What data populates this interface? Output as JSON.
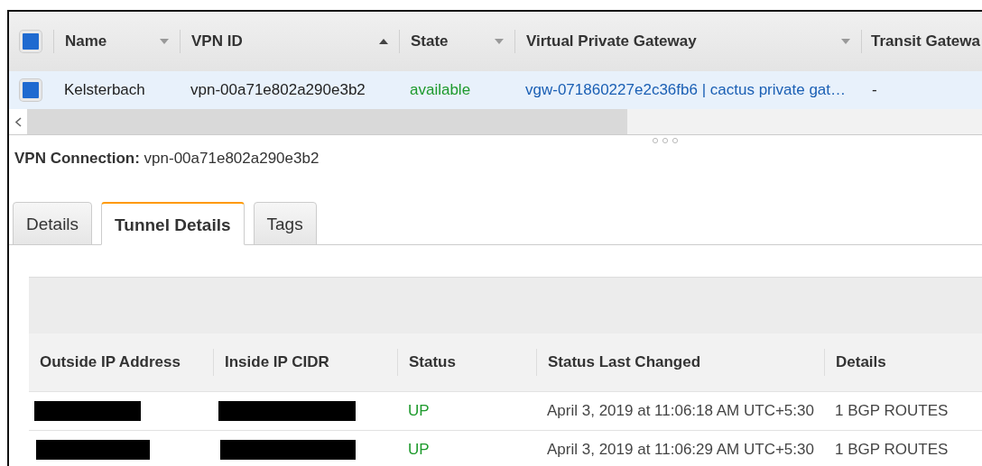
{
  "list_table": {
    "select_all": {
      "checked": true
    },
    "columns": [
      {
        "label": "Name",
        "sorted": false,
        "menu": true
      },
      {
        "label": "VPN ID",
        "sorted": true,
        "menu": true
      },
      {
        "label": "State",
        "sorted": false,
        "menu": true
      },
      {
        "label": "Virtual Private Gateway",
        "sorted": false,
        "menu": true
      },
      {
        "label": "Transit Gatewa",
        "sorted": false,
        "menu": false
      }
    ],
    "rows": [
      {
        "checked": true,
        "selected": true,
        "name": "Kelsterbach",
        "vpn_id": "vpn-00a71e802a290e3b2",
        "state": "available",
        "gateway": "vgw-071860227e2c36fb6 | cactus private gat…",
        "transit": "-"
      }
    ]
  },
  "detail": {
    "label": "VPN Connection:",
    "value": "vpn-00a71e802a290e3b2",
    "tabs": [
      {
        "label": "Details",
        "selected": false
      },
      {
        "label": "Tunnel Details",
        "selected": true
      },
      {
        "label": "Tags",
        "selected": false
      }
    ],
    "tunnels": {
      "columns": [
        "Outside IP Address",
        "Inside IP CIDR",
        "Status",
        "Status Last Changed",
        "Details"
      ],
      "rows": [
        {
          "status": "UP",
          "changed": "April 3, 2019 at 11:06:18 AM UTC+5:30",
          "details": "1 BGP ROUTES"
        },
        {
          "status": "UP",
          "changed": "April 3, 2019 at 11:06:29 AM UTC+5:30",
          "details": "1 BGP ROUTES"
        }
      ]
    }
  }
}
